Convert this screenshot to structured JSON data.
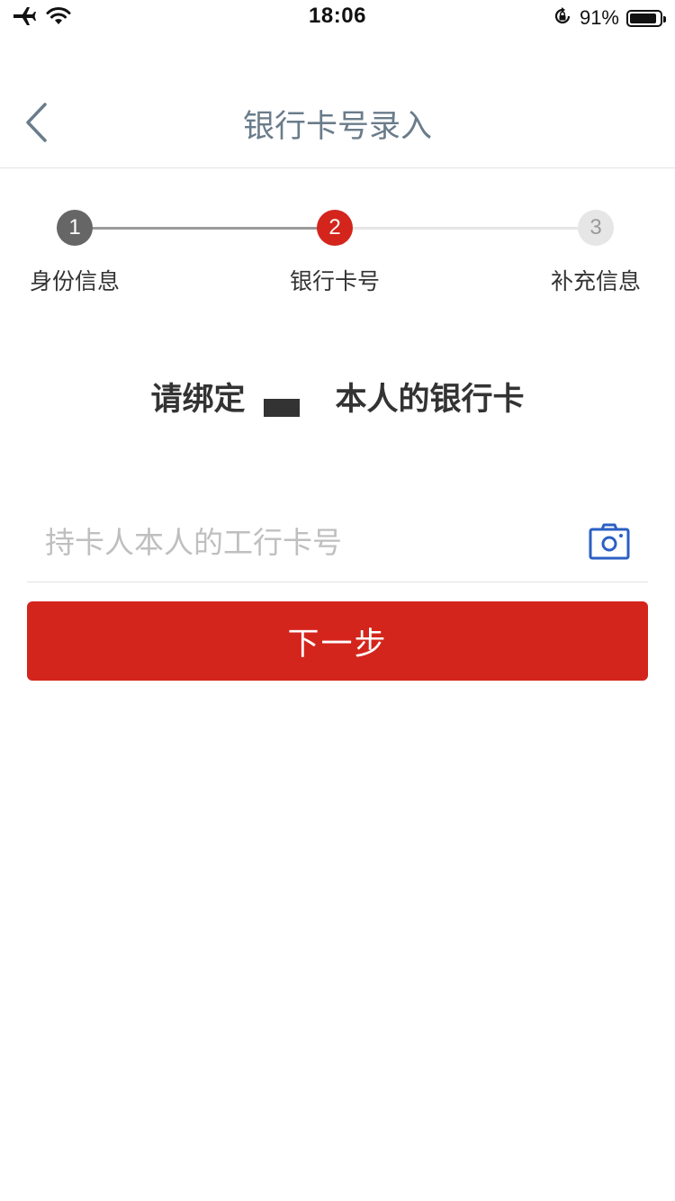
{
  "status_bar": {
    "time": "18:06",
    "battery_percent": "91%",
    "battery_level": 0.91,
    "icons": [
      "airplane-icon",
      "wifi-icon",
      "orientation-lock-icon",
      "battery-icon"
    ]
  },
  "nav": {
    "title": "银行卡号录入",
    "back_icon": "chevron-left-icon"
  },
  "stepper": {
    "steps": [
      {
        "number": "1",
        "label": "身份信息",
        "state": "done"
      },
      {
        "number": "2",
        "label": "银行卡号",
        "state": "active"
      },
      {
        "number": "3",
        "label": "补充信息",
        "state": "todo"
      }
    ]
  },
  "headline": {
    "prefix": "请绑定",
    "suffix": "本人的银行卡"
  },
  "card_input": {
    "value": "",
    "placeholder": "持卡人本人的工行卡号",
    "camera_icon": "camera-icon"
  },
  "actions": {
    "next_label": "下一步"
  },
  "colors": {
    "accent": "#d3251c",
    "title_gray": "#6a7c8a",
    "step_done": "#666666",
    "step_todo": "#e6e6e6",
    "icon_blue": "#2b5fc4",
    "placeholder": "#bfbfbf"
  }
}
